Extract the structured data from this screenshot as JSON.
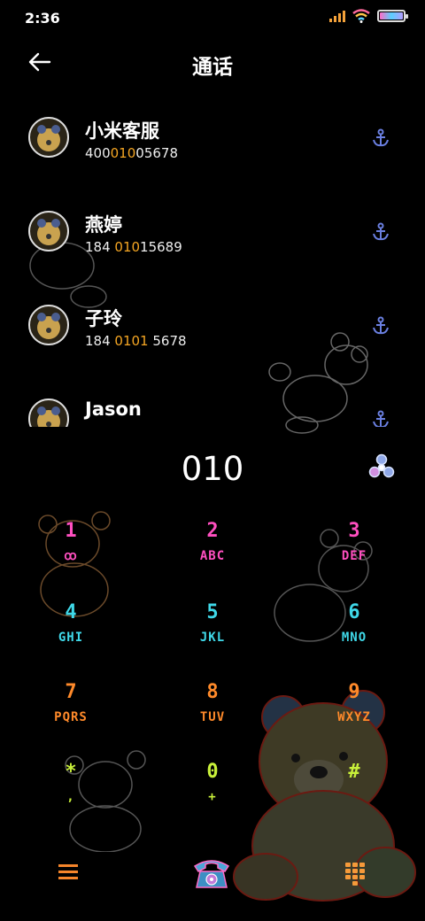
{
  "status": {
    "time": "2:36"
  },
  "header": {
    "title": "通话"
  },
  "contacts": [
    {
      "name": "小米客服",
      "num_pre": "400",
      "num_match": "010",
      "num_post": "05678"
    },
    {
      "name": "燕婷",
      "num_pre": "184 ",
      "num_match": "010",
      "num_post": "15689"
    },
    {
      "name": "子玲",
      "num_pre": "184 ",
      "num_match": "0101",
      "num_post": " 5678"
    },
    {
      "name": "Jason",
      "num_pre": "",
      "num_match": "",
      "num_post": ""
    }
  ],
  "dial": {
    "entered": "010"
  },
  "keys": [
    {
      "digit": "1",
      "letters": "ꝏ",
      "color": "#ff4fc0"
    },
    {
      "digit": "2",
      "letters": "ABC",
      "color": "#ff4fc0"
    },
    {
      "digit": "3",
      "letters": "DEF",
      "color": "#ff4fc0"
    },
    {
      "digit": "4",
      "letters": "GHI",
      "color": "#3fd8e8"
    },
    {
      "digit": "5",
      "letters": "JKL",
      "color": "#3fd8e8"
    },
    {
      "digit": "6",
      "letters": "MNO",
      "color": "#3fd8e8"
    },
    {
      "digit": "7",
      "letters": "PQRS",
      "color": "#ff8a2a"
    },
    {
      "digit": "8",
      "letters": "TUV",
      "color": "#ff8a2a"
    },
    {
      "digit": "9",
      "letters": "WXYZ",
      "color": "#ff8a2a"
    },
    {
      "digit": "*",
      "letters": ",",
      "color": "#c8f03a"
    },
    {
      "digit": "0",
      "letters": "+",
      "color": "#c8f03a"
    },
    {
      "digit": "#",
      "letters": "",
      "color": "#c8f03a"
    }
  ],
  "icons": {
    "back": "arrow-left-icon",
    "anchor": "anchor-icon",
    "delete": "spinner-delete-icon",
    "menu": "menu-icon",
    "call": "telephone-icon",
    "dialpad": "dialpad-icon"
  },
  "colors": {
    "match": "#f5a623",
    "background": "#000000"
  }
}
